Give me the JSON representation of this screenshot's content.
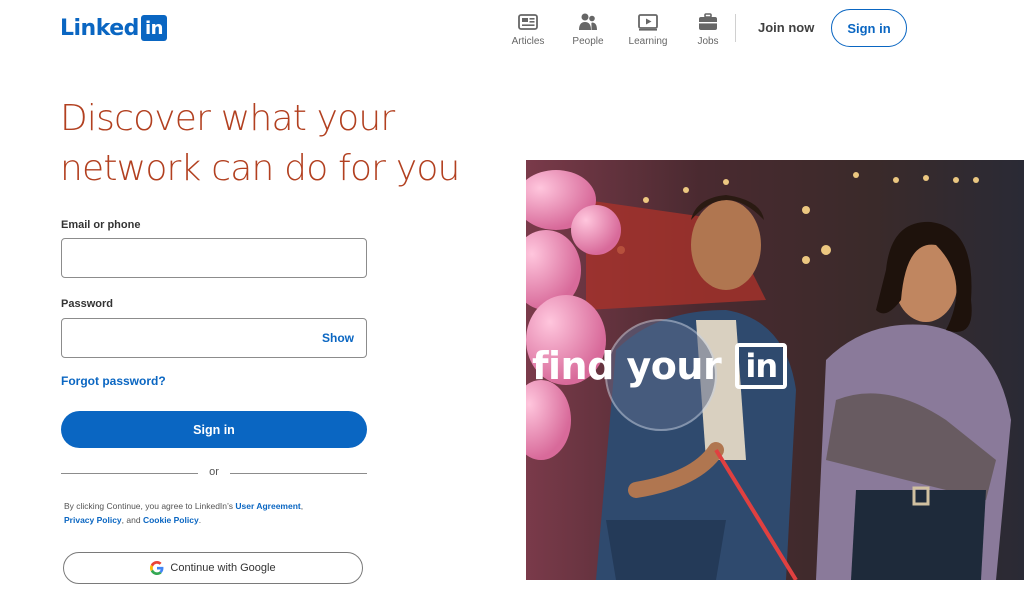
{
  "header": {
    "logo_text": "Linked",
    "logo_box_text": "in",
    "nav": [
      {
        "label": "Articles",
        "icon": "articles-icon"
      },
      {
        "label": "People",
        "icon": "people-icon"
      },
      {
        "label": "Learning",
        "icon": "learning-icon"
      },
      {
        "label": "Jobs",
        "icon": "jobs-icon"
      }
    ],
    "join_now": "Join now",
    "sign_in": "Sign in"
  },
  "hero": {
    "headline_line1": "Discover what your",
    "headline_line2": "network can do for you"
  },
  "form": {
    "email_label": "Email or phone",
    "email_value": "",
    "password_label": "Password",
    "password_value": "",
    "show_label": "Show",
    "forgot_password": "Forgot password?",
    "sign_in_button": "Sign in",
    "divider_text": "or",
    "legal": {
      "prefix": "By clicking Continue, you agree to LinkedIn’s ",
      "user_agreement": "User Agreement",
      "comma": ",",
      "privacy_policy": "Privacy Policy",
      "and": ", and ",
      "cookie_policy": "Cookie Policy",
      "period": "."
    },
    "google_button": "Continue with Google"
  },
  "image": {
    "overlay_text": "find your",
    "overlay_box_text": "in"
  },
  "colors": {
    "brand": "#0a66c2",
    "headline": "#b24020"
  }
}
